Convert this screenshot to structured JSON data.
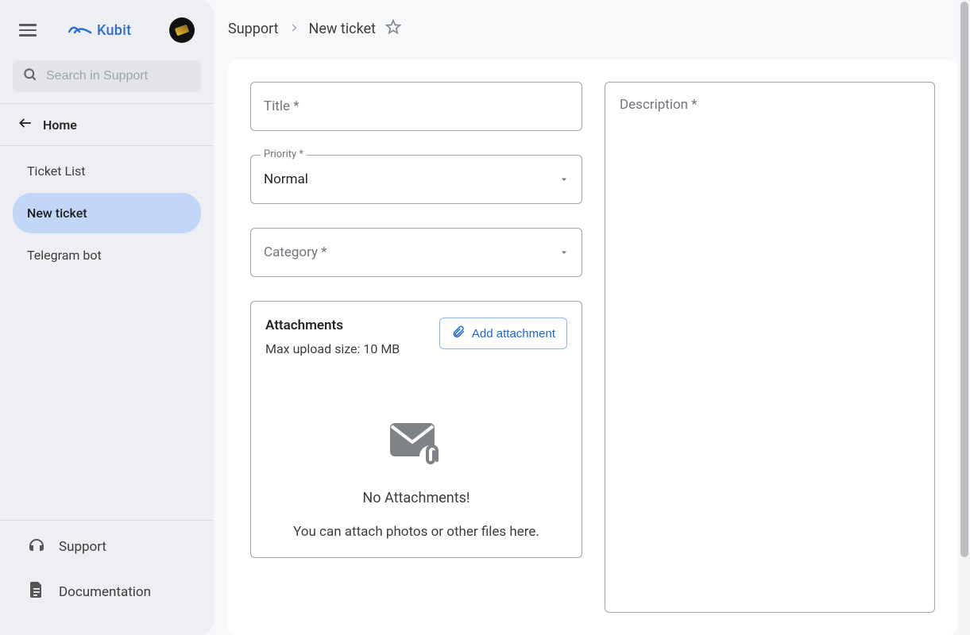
{
  "brand": {
    "name": "Kubit"
  },
  "search": {
    "placeholder": "Search in Support"
  },
  "nav": {
    "home_label": "Home",
    "items": [
      {
        "label": "Ticket List",
        "active": false
      },
      {
        "label": "New ticket",
        "active": true
      },
      {
        "label": "Telegram bot",
        "active": false
      }
    ]
  },
  "sidebar_bottom": {
    "support_label": "Support",
    "documentation_label": "Documentation"
  },
  "breadcrumb": {
    "root": "Support",
    "current": "New ticket"
  },
  "form": {
    "title_label": "Title *",
    "priority_label": "Priority *",
    "priority_value": "Normal",
    "category_label": "Category *",
    "description_label": "Description *"
  },
  "attachments": {
    "title": "Attachments",
    "max_size": "Max upload size: 10 MB",
    "add_button": "Add attachment",
    "empty_title": "No Attachments!",
    "empty_hint": "You can attach photos or other files here."
  }
}
